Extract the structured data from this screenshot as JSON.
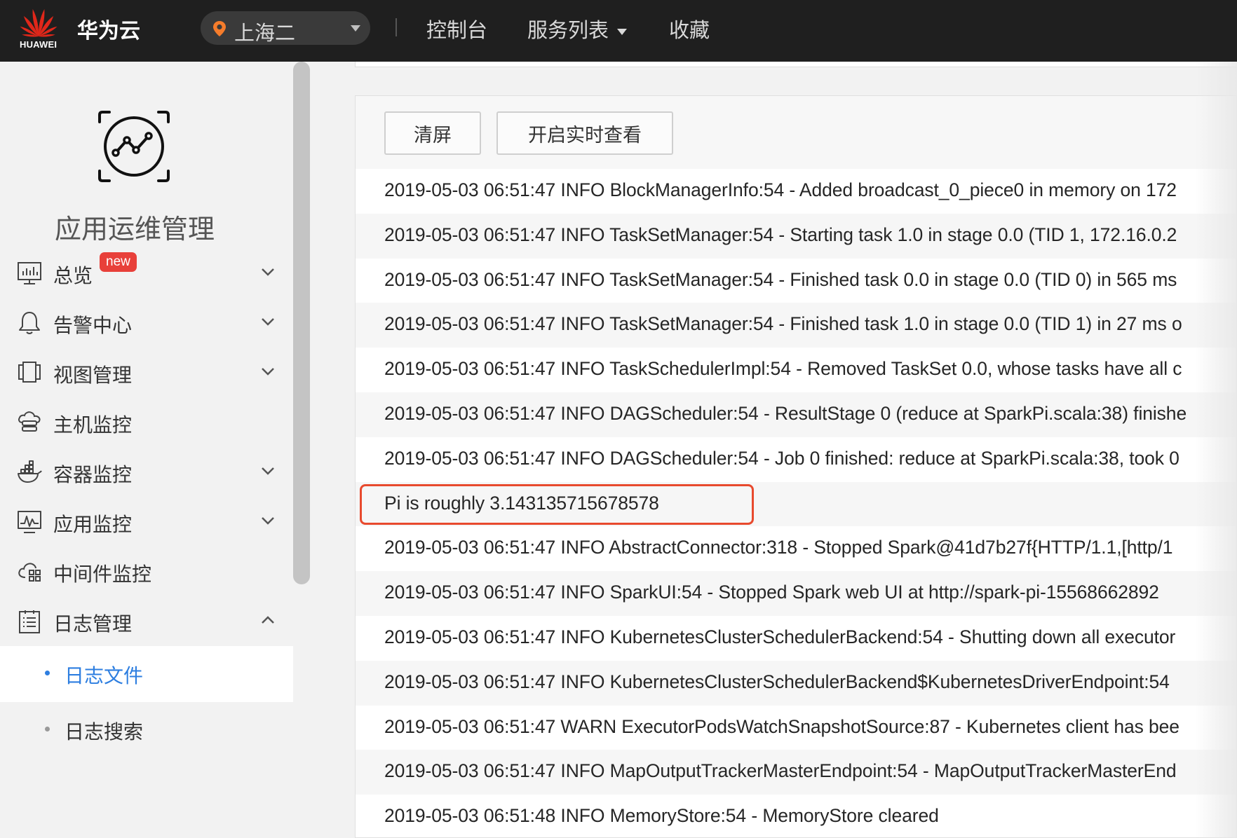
{
  "header": {
    "logo_text": "HUAWEI",
    "brand": "华为云",
    "region": "上海二",
    "nav": {
      "console": "控制台",
      "services": "服务列表",
      "favorites": "收藏"
    }
  },
  "sidebar": {
    "app_title": "应用运维管理",
    "items": [
      {
        "label": "总览",
        "icon": "dashboard-icon",
        "badge": "new",
        "chevron": "down"
      },
      {
        "label": "告警中心",
        "icon": "bell-icon",
        "chevron": "down"
      },
      {
        "label": "视图管理",
        "icon": "view-icon",
        "chevron": "down"
      },
      {
        "label": "主机监控",
        "icon": "host-icon"
      },
      {
        "label": "容器监控",
        "icon": "container-icon",
        "chevron": "down"
      },
      {
        "label": "应用监控",
        "icon": "app-monitor-icon",
        "chevron": "down"
      },
      {
        "label": "中间件监控",
        "icon": "middleware-icon"
      },
      {
        "label": "日志管理",
        "icon": "log-icon",
        "chevron": "up"
      }
    ],
    "sub_items": [
      {
        "label": "日志文件",
        "active": true
      },
      {
        "label": "日志搜索",
        "active": false
      }
    ]
  },
  "toolbar": {
    "clear_label": "清屏",
    "live_label": "开启实时查看"
  },
  "logs": [
    "2019-05-03 06:51:47 INFO  BlockManagerInfo:54 - Added broadcast_0_piece0 in memory on 172",
    "2019-05-03 06:51:47 INFO  TaskSetManager:54 - Starting task 1.0 in stage 0.0 (TID 1, 172.16.0.2",
    "2019-05-03 06:51:47 INFO  TaskSetManager:54 - Finished task 0.0 in stage 0.0 (TID 0) in 565 ms",
    "2019-05-03 06:51:47 INFO  TaskSetManager:54 - Finished task 1.0 in stage 0.0 (TID 1) in 27 ms o",
    "2019-05-03 06:51:47 INFO  TaskSchedulerImpl:54 - Removed TaskSet 0.0, whose tasks have all c",
    "2019-05-03 06:51:47 INFO  DAGScheduler:54 - ResultStage 0 (reduce at SparkPi.scala:38) finishe",
    "2019-05-03 06:51:47 INFO  DAGScheduler:54 - Job 0 finished: reduce at SparkPi.scala:38, took 0",
    "Pi is roughly 3.143135715678578",
    "2019-05-03 06:51:47 INFO  AbstractConnector:318 - Stopped Spark@41d7b27f{HTTP/1.1,[http/1",
    "2019-05-03 06:51:47 INFO  SparkUI:54 - Stopped Spark web UI at http://spark-pi-15568662892",
    "2019-05-03 06:51:47 INFO  KubernetesClusterSchedulerBackend:54 - Shutting down all executor",
    "2019-05-03 06:51:47 INFO  KubernetesClusterSchedulerBackend$KubernetesDriverEndpoint:54",
    "2019-05-03 06:51:47 WARN  ExecutorPodsWatchSnapshotSource:87 - Kubernetes client has bee",
    "2019-05-03 06:51:47 INFO  MapOutputTrackerMasterEndpoint:54 - MapOutputTrackerMasterEnd",
    "2019-05-03 06:51:48 INFO  MemoryStore:54 - MemoryStore cleared"
  ],
  "highlight_log_index": 7,
  "colors": {
    "topbar": "#1f1f1f",
    "active_link": "#2d7ee0",
    "badge": "#e8403a",
    "highlight_border": "#e84a2e"
  }
}
